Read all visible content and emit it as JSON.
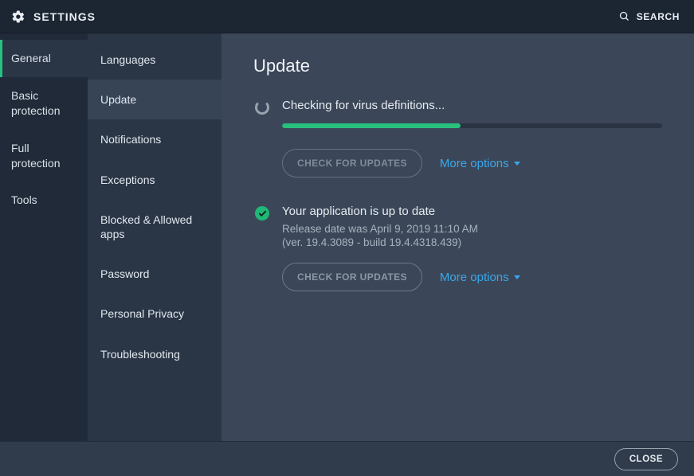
{
  "topbar": {
    "title": "SETTINGS",
    "search_label": "SEARCH"
  },
  "sidebar_primary": {
    "items": [
      {
        "label": "General",
        "active": true
      },
      {
        "label": "Basic protection",
        "active": false
      },
      {
        "label": "Full protection",
        "active": false
      },
      {
        "label": "Tools",
        "active": false
      }
    ]
  },
  "sidebar_secondary": {
    "items": [
      {
        "label": "Languages",
        "active": false
      },
      {
        "label": "Update",
        "active": true
      },
      {
        "label": "Notifications",
        "active": false
      },
      {
        "label": "Exceptions",
        "active": false
      },
      {
        "label": "Blocked & Allowed apps",
        "active": false
      },
      {
        "label": "Password",
        "active": false
      },
      {
        "label": "Personal Privacy",
        "active": false
      },
      {
        "label": "Troubleshooting",
        "active": false
      }
    ]
  },
  "main": {
    "heading": "Update",
    "checking": {
      "status": "Checking for virus definitions...",
      "progress_percent": 47,
      "button": "CHECK FOR UPDATES",
      "more": "More options"
    },
    "uptodate": {
      "status": "Your application is up to date",
      "release": "Release date was April 9, 2019 11:10 AM",
      "version": "(ver. 19.4.3089 - build 19.4.4318.439)",
      "button": "CHECK FOR UPDATES",
      "more": "More options"
    }
  },
  "footer": {
    "close": "CLOSE"
  },
  "colors": {
    "accent_green": "#27c07c",
    "link_blue": "#3aa7ea"
  }
}
